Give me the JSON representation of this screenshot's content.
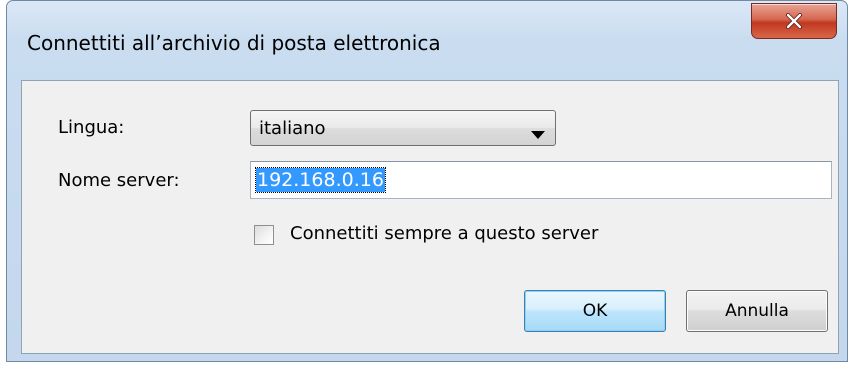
{
  "dialog": {
    "title": "Connettiti all’archivio di posta elettronica",
    "close_icon": "close-icon"
  },
  "form": {
    "language_label": "Lingua:",
    "language_value": "italiano",
    "dropdown_icon": "chevron-down-icon",
    "server_label": "Nome server:",
    "server_value": "192.168.0.16",
    "always_connect_label": "Connettiti sempre a questo server",
    "always_connect_checked": false
  },
  "buttons": {
    "ok_label": "OK",
    "cancel_label": "Annulla"
  },
  "colors": {
    "selection": "#3399ff",
    "close_button": "#c74a33",
    "frame": "#c4d7ec"
  }
}
